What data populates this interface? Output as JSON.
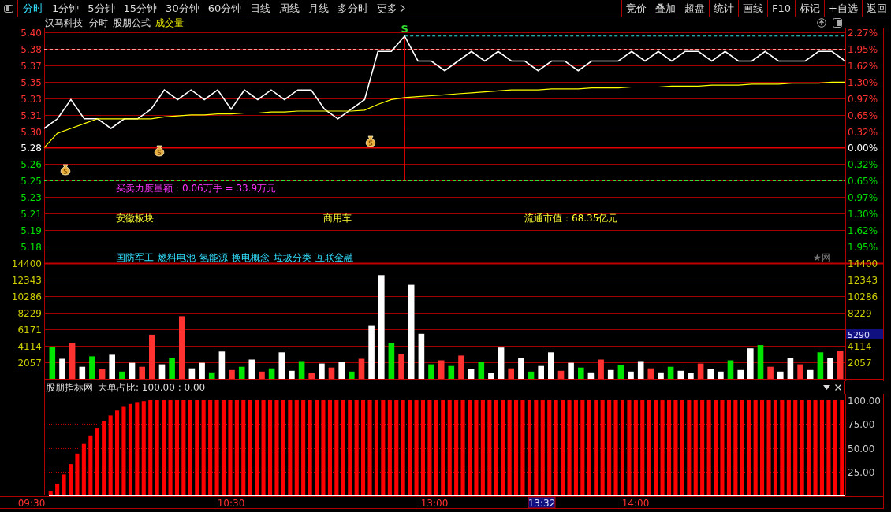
{
  "toolbar": {
    "tabs": [
      {
        "label": "分时",
        "selected": true
      },
      {
        "label": "1分钟",
        "selected": false
      },
      {
        "label": "5分钟",
        "selected": false
      },
      {
        "label": "15分钟",
        "selected": false
      },
      {
        "label": "30分钟",
        "selected": false
      },
      {
        "label": "60分钟",
        "selected": false
      },
      {
        "label": "日线",
        "selected": false
      },
      {
        "label": "周线",
        "selected": false
      },
      {
        "label": "月线",
        "selected": false
      },
      {
        "label": "多分时",
        "selected": false
      }
    ],
    "more": "更多",
    "buttons": [
      "竞价",
      "叠加",
      "超盘",
      "统计",
      "画线",
      "F10",
      "标记",
      "+自选",
      "返回"
    ]
  },
  "title_row": {
    "stock": "汉马科技",
    "period": "分时",
    "formula": "股朋公式",
    "indicator": "成交量"
  },
  "price_chart": {
    "chart_data": {
      "type": "line",
      "grid": true,
      "ylim": [
        5.16,
        5.3999
      ],
      "yticks": [
        {
          "value": 5.3999,
          "label": "5.40"
        },
        {
          "value": 5.383,
          "label": "5.38"
        },
        {
          "value": 5.3655,
          "label": "5.37"
        },
        {
          "value": 5.3486,
          "label": "5.35"
        },
        {
          "value": 5.3312,
          "label": "5.33"
        },
        {
          "value": 5.3143,
          "label": "5.31"
        },
        {
          "value": 5.2969,
          "label": "5.30"
        },
        {
          "value": 5.28,
          "label": "5.28"
        },
        {
          "value": 5.2631,
          "label": "5.26"
        },
        {
          "value": 5.2457,
          "label": "5.25"
        },
        {
          "value": 5.2288,
          "label": "5.23"
        },
        {
          "value": 5.2114,
          "label": "5.21"
        },
        {
          "value": 5.1945,
          "label": "5.19"
        },
        {
          "value": 5.177,
          "label": "5.18"
        }
      ],
      "series": [
        {
          "color": "#ffffff",
          "values": [
            5.3,
            5.31,
            5.33,
            5.31,
            5.31,
            5.3,
            5.31,
            5.31,
            5.32,
            5.34,
            5.33,
            5.34,
            5.33,
            5.34,
            5.32,
            5.34,
            5.33,
            5.34,
            5.33,
            5.34,
            5.34,
            5.32,
            5.31,
            5.32,
            5.33,
            5.38,
            5.38,
            5.396,
            5.37,
            5.37,
            5.36,
            5.37,
            5.38,
            5.37,
            5.38,
            5.37,
            5.37,
            5.36,
            5.37,
            5.37,
            5.36,
            5.37,
            5.37,
            5.37,
            5.38,
            5.37,
            5.38,
            5.37,
            5.38,
            5.38,
            5.37,
            5.38,
            5.37,
            5.37,
            5.38,
            5.37,
            5.37,
            5.37,
            5.38,
            5.38,
            5.37
          ]
        },
        {
          "color": "#ffff00",
          "values": [
            5.28,
            5.295,
            5.3,
            5.305,
            5.31,
            5.31,
            5.31,
            5.31,
            5.31,
            5.312,
            5.313,
            5.314,
            5.314,
            5.315,
            5.315,
            5.316,
            5.316,
            5.317,
            5.317,
            5.318,
            5.318,
            5.318,
            5.318,
            5.318,
            5.319,
            5.325,
            5.33,
            5.332,
            5.333,
            5.334,
            5.335,
            5.336,
            5.337,
            5.338,
            5.339,
            5.34,
            5.34,
            5.34,
            5.341,
            5.341,
            5.341,
            5.342,
            5.342,
            5.342,
            5.343,
            5.343,
            5.343,
            5.344,
            5.344,
            5.344,
            5.345,
            5.345,
            5.345,
            5.346,
            5.346,
            5.346,
            5.347,
            5.347,
            5.347,
            5.348,
            5.348
          ]
        }
      ],
      "ref_lines": [
        {
          "axis": "y",
          "value": 5.28,
          "color": "#e00000"
        },
        {
          "axis": "y",
          "value": 5.383,
          "color": "#ff9a9a"
        },
        {
          "axis": "y",
          "value": 5.2457,
          "color": "#33dd33"
        }
      ]
    }
  },
  "percent_axis": [
    "2.27%",
    "1.95%",
    "1.62%",
    "1.30%",
    "0.97%",
    "0.65%",
    "0.32%",
    "0.00%",
    "0.32%",
    "0.65%",
    "0.97%",
    "1.30%",
    "1.62%",
    "1.95%"
  ],
  "signal_label": "S",
  "info": {
    "order_strength": "买卖力度量额：0.06万手 = 33.9万元",
    "sector": "安徽板块",
    "industry": "商用车",
    "market_cap": "流通市值：68.35亿元",
    "concepts": [
      "国防军工",
      "燃料电池",
      "氢能源",
      "换电概念",
      "垃圾分类",
      "互联金融"
    ],
    "source_mark": "★网"
  },
  "volume_chart": {
    "chart_data": {
      "type": "bar",
      "grid": true,
      "ylim": [
        0,
        14400
      ],
      "yticks": [
        {
          "value": 14400,
          "label": "14400"
        },
        {
          "value": 12343,
          "label": "12343"
        },
        {
          "value": 10286,
          "label": "10286"
        },
        {
          "value": 8229,
          "label": "8229"
        },
        {
          "value": 6171,
          "label": "6171"
        },
        {
          "value": 4114,
          "label": "4114"
        },
        {
          "value": 2057,
          "label": "2057"
        }
      ],
      "series": [
        {
          "color": "#ff3232",
          "values": [
            null,
            null,
            4500,
            null,
            null,
            1200,
            null,
            null,
            null,
            1500,
            5500,
            null,
            null,
            7800,
            null,
            null,
            null,
            null,
            1100,
            null,
            null,
            900,
            null,
            null,
            null,
            null,
            700,
            null,
            1400,
            null,
            null,
            2500,
            null,
            null,
            null,
            3100,
            null,
            null,
            null,
            2300,
            null,
            2900,
            null,
            null,
            null,
            null,
            1300,
            null,
            null,
            null,
            null,
            1000,
            null,
            null,
            null,
            2400,
            null,
            null,
            null,
            null,
            1300,
            null,
            null,
            null,
            null,
            1900,
            null,
            null,
            null,
            null,
            null,
            null,
            1500,
            null,
            null,
            1800,
            null,
            null,
            null,
            3500
          ]
        },
        {
          "color": "#00e600",
          "values": [
            4000,
            null,
            null,
            null,
            2800,
            null,
            null,
            900,
            null,
            null,
            null,
            null,
            2600,
            null,
            null,
            null,
            800,
            null,
            null,
            1500,
            null,
            null,
            1300,
            null,
            null,
            2200,
            null,
            null,
            null,
            null,
            900,
            null,
            null,
            null,
            4500,
            null,
            null,
            null,
            1800,
            null,
            1600,
            null,
            null,
            2100,
            null,
            null,
            null,
            null,
            900,
            null,
            null,
            null,
            null,
            1400,
            null,
            null,
            null,
            1700,
            null,
            null,
            null,
            null,
            1500,
            null,
            null,
            null,
            null,
            null,
            2300,
            null,
            null,
            4200,
            null,
            null,
            null,
            null,
            null,
            3300,
            null,
            null
          ]
        },
        {
          "color": "#ffffff",
          "values": [
            null,
            2500,
            null,
            1500,
            null,
            null,
            3000,
            null,
            2000,
            null,
            null,
            1800,
            null,
            null,
            1300,
            2000,
            null,
            3400,
            null,
            null,
            2400,
            null,
            null,
            3300,
            1000,
            null,
            null,
            1900,
            null,
            2100,
            null,
            null,
            6600,
            12900,
            null,
            null,
            11700,
            5600,
            null,
            null,
            null,
            null,
            1200,
            null,
            700,
            3900,
            null,
            2600,
            null,
            1600,
            3300,
            null,
            2000,
            null,
            800,
            null,
            1100,
            null,
            900,
            2200,
            null,
            800,
            null,
            1000,
            700,
            null,
            1200,
            900,
            null,
            1100,
            3800,
            null,
            null,
            900,
            2600,
            null,
            1100,
            null,
            2600,
            null
          ]
        }
      ]
    }
  },
  "volume_right_axis": [
    "14400",
    "12343",
    "10286",
    "8229",
    "4114",
    "2057"
  ],
  "volume_cursor": "5290",
  "indicator_panel": {
    "source": "股朋指标网",
    "reading": "大单占比: 100.00 : 0.00",
    "chart_data": {
      "type": "bar",
      "grid": true,
      "ylim": [
        0,
        100
      ],
      "yticks": [
        {
          "value": 100,
          "label": "100.00"
        },
        {
          "value": 75,
          "label": "75.00"
        },
        {
          "value": 50,
          "label": "50.00"
        },
        {
          "value": 25,
          "label": "25.00"
        }
      ],
      "series": [
        {
          "color": "#ff0000",
          "values": [
            5,
            12,
            22,
            33,
            44,
            54,
            63,
            71,
            78,
            84,
            89,
            93,
            96,
            98,
            99,
            100,
            100,
            100,
            100,
            100,
            100,
            100,
            100,
            100,
            100,
            100,
            100,
            100,
            100,
            100,
            100,
            100,
            100,
            100,
            100,
            100,
            100,
            100,
            100,
            100,
            100,
            100,
            100,
            100,
            100,
            100,
            100,
            100,
            100,
            100,
            100,
            100,
            100,
            100,
            100,
            100,
            100,
            100,
            100,
            100,
            100,
            100,
            100,
            100,
            100,
            100,
            100,
            100,
            100,
            100,
            100,
            100,
            100,
            100,
            100,
            100,
            100,
            100,
            100,
            100,
            100,
            100,
            100,
            100,
            100,
            100,
            100,
            100,
            100,
            100,
            100,
            100,
            100,
            100,
            100,
            100,
            100,
            100,
            100,
            100,
            100,
            100,
            100,
            100,
            100,
            100,
            100,
            100,
            100,
            100,
            100,
            100,
            100,
            100,
            100,
            100,
            100,
            100,
            100,
            100
          ]
        }
      ]
    }
  },
  "time_axis": {
    "labels": [
      "09:30",
      "10:30",
      "13:00",
      "14:00"
    ],
    "cursor": "13:32"
  }
}
